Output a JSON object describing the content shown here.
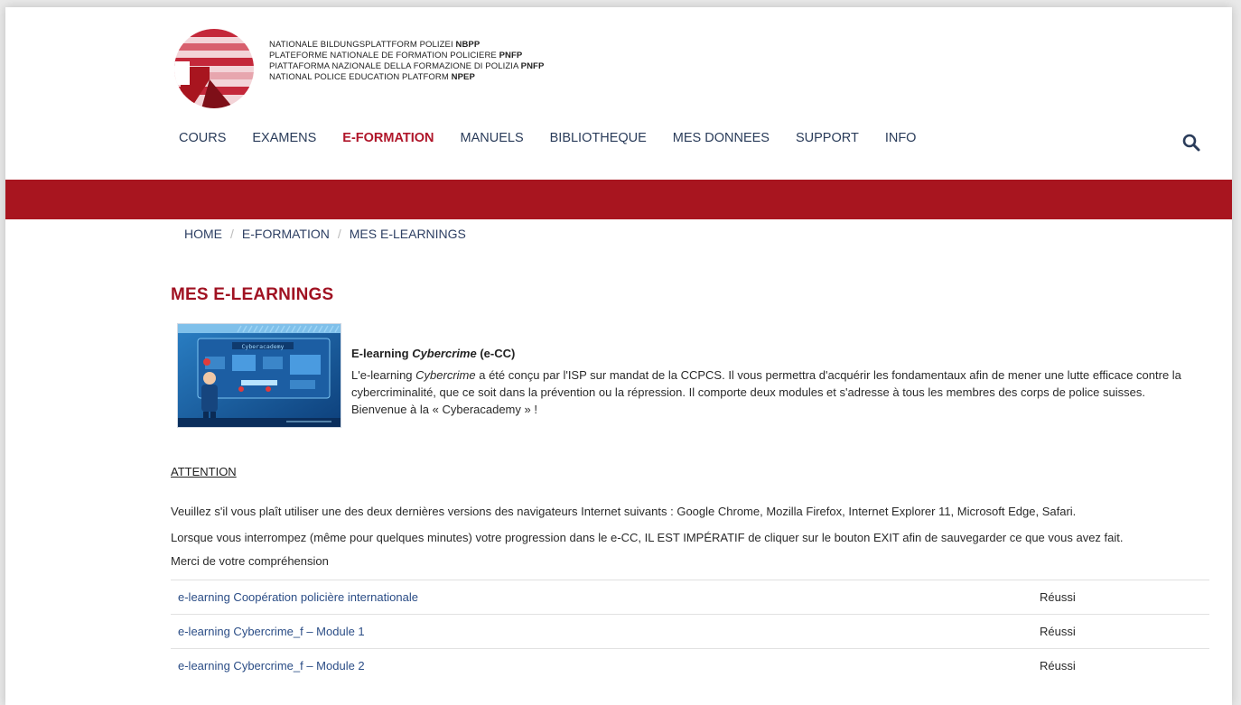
{
  "brand": {
    "lines": [
      {
        "text": "NATIONALE BILDUNGSPLATTFORM POLIZEI",
        "abbr": "NBPP"
      },
      {
        "text": "PLATEFORME NATIONALE DE FORMATION POLICIERE",
        "abbr": "PNFP"
      },
      {
        "text": "PIATTAFORMA NAZIONALE DELLA FORMAZIONE DI POLIZIA",
        "abbr": "PNFP"
      },
      {
        "text": "NATIONAL POLICE EDUCATION PLATFORM",
        "abbr": "NPEP"
      }
    ]
  },
  "nav": {
    "items": [
      {
        "label": "COURS"
      },
      {
        "label": "EXAMENS"
      },
      {
        "label": "E-FORMATION",
        "active": true
      },
      {
        "label": "MANUELS"
      },
      {
        "label": "BIBLIOTHEQUE"
      },
      {
        "label": "MES DONNEES"
      },
      {
        "label": "SUPPORT"
      },
      {
        "label": "INFO"
      }
    ],
    "search_icon": "search-icon"
  },
  "breadcrumb": {
    "items": [
      "HOME",
      "E-FORMATION",
      "MES E-LEARNINGS"
    ],
    "separator": "/"
  },
  "page": {
    "title": "MES E-LEARNINGS"
  },
  "course": {
    "title_prefix": "E-learning ",
    "title_italic": "Cybercrime",
    "title_suffix": " (e-CC)",
    "thumbnail_text": "Cyberacademy",
    "desc_prefix": "L'e-learning ",
    "desc_italic": "Cybercrime",
    "desc_rest": " a été conçu par l'ISP sur mandat de la CCPCS. Il vous permettra d'acquérir les fondamentaux afin de mener une lutte efficace contre la cybercriminalité, que ce soit dans la prévention ou la répression. Il comporte deux modules et s'adresse à tous les membres des corps de police suisses. Bienvenue à la « Cyberacademy » !"
  },
  "attention": {
    "title": "ATTENTION",
    "line1": "Veuillez s'il vous plaît utiliser une des deux dernières versions des navigateurs Internet suivants : Google Chrome, Mozilla Firefox, Internet Explorer 11, Microsoft Edge, Safari.",
    "line2": "Lorsque vous interrompez (même pour quelques minutes) votre progression dans le e-CC, IL EST IMPÉRATIF de cliquer sur le bouton EXIT afin de sauvegarder ce que vous avez fait.",
    "line3": "Merci de votre compréhension"
  },
  "elearnings": [
    {
      "name": "e-learning Coopération policière internationale",
      "status": "Réussi"
    },
    {
      "name": "e-learning Cybercrime_f – Module 1",
      "status": "Réussi"
    },
    {
      "name": "e-learning Cybercrime_f – Module 2",
      "status": "Réussi"
    }
  ],
  "colors": {
    "brand_red": "#a8151f",
    "title_red": "#a01222",
    "nav_blue": "#2a3c5a",
    "link_blue": "#2b4d86"
  }
}
